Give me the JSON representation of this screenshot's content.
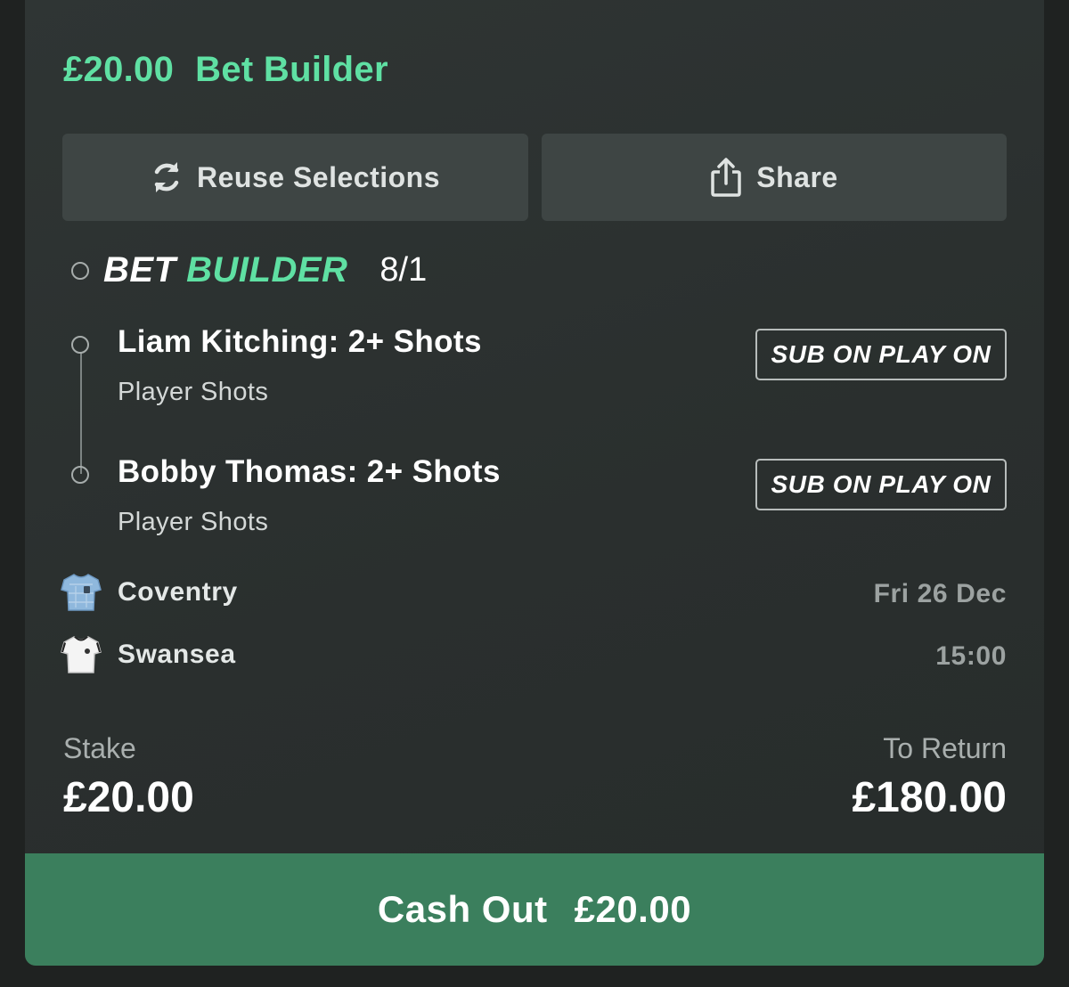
{
  "header": {
    "amount": "£20.00",
    "title": "Bet Builder"
  },
  "actions": {
    "reuse_label": "Reuse Selections",
    "share_label": "Share"
  },
  "bet_builder": {
    "title_word1": "BET",
    "title_word2": "BUILDER",
    "odds": "8/1"
  },
  "selections": [
    {
      "title": "Liam Kitching: 2+ Shots",
      "market": "Player Shots",
      "badge": "SUB ON PLAY ON"
    },
    {
      "title": "Bobby Thomas: 2+ Shots",
      "market": "Player Shots",
      "badge": "SUB ON PLAY ON"
    }
  ],
  "event": {
    "home_team": "Coventry",
    "away_team": "Swansea",
    "date": "Fri 26 Dec",
    "time": "15:00"
  },
  "stake": {
    "label": "Stake",
    "value": "£20.00"
  },
  "to_return": {
    "label": "To Return",
    "value": "£180.00"
  },
  "cashout": {
    "label": "Cash Out",
    "amount": "£20.00"
  },
  "colors": {
    "accent": "#5fe0a3",
    "cashout_bg": "#3b7f5d",
    "card_bg": "#2d3231"
  }
}
